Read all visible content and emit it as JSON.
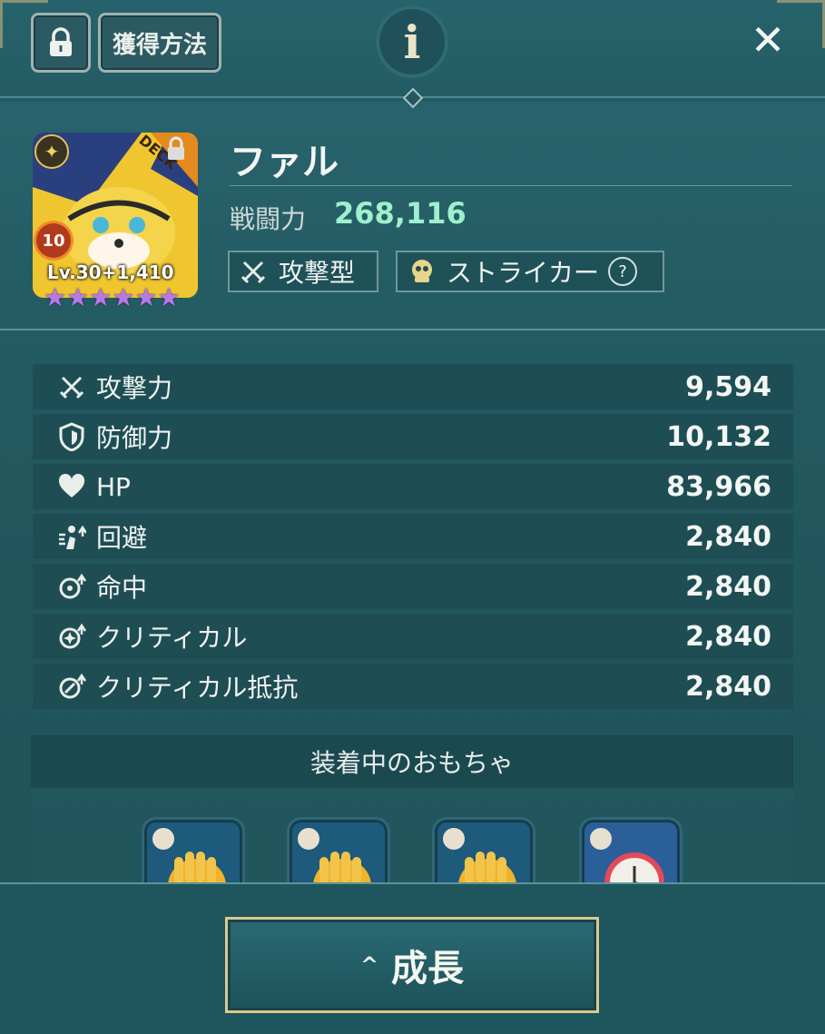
{
  "top": {
    "acquire_label": "獲得方法",
    "info_label": "i",
    "close_label": "✕"
  },
  "unit": {
    "name": "ファル",
    "power_label": "戦闘力",
    "power_value": "268,116",
    "level_text": "Lv.30+1,410",
    "rank_badge": "10",
    "deck_badge": "DECK",
    "stars": 6,
    "tags": [
      {
        "label": "攻撃型",
        "icon": "crossed-swords-icon"
      },
      {
        "label": "ストライカー",
        "icon": "striker-icon",
        "help": "?"
      }
    ]
  },
  "stats": [
    {
      "icon": "attack-icon",
      "label": "攻撃力",
      "value": "9,594"
    },
    {
      "icon": "shield-icon",
      "label": "防御力",
      "value": "10,132"
    },
    {
      "icon": "heart-icon",
      "label": "HP",
      "value": "83,966"
    },
    {
      "icon": "evasion-icon",
      "label": "回避",
      "value": "2,840"
    },
    {
      "icon": "accuracy-icon",
      "label": "命中",
      "value": "2,840"
    },
    {
      "icon": "critical-icon",
      "label": "クリティカル",
      "value": "2,840"
    },
    {
      "icon": "critical-resist-icon",
      "label": "クリティカル抵抗",
      "value": "2,840"
    }
  ],
  "toys": {
    "header": "装着中のおもちゃ",
    "items": [
      "glove-toy",
      "glove-toy",
      "glove-toy",
      "clock-toy"
    ]
  },
  "actions": {
    "grow_label": "成長"
  },
  "colors": {
    "accent_power": "#9ff0cd",
    "gold_frame": "#d9c98e",
    "panel": "#1e4b52"
  }
}
